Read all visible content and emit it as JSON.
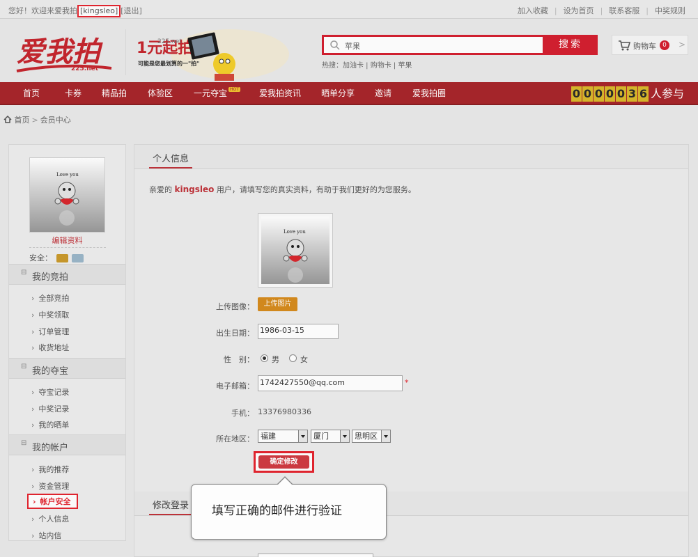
{
  "topbar": {
    "welcome_prefix": "您好！欢迎来爱我拍",
    "username": "[kingsleo]",
    "logout": "[退出]",
    "links": [
      "加入收藏",
      "设为首页",
      "联系客服",
      "中奖规则"
    ]
  },
  "header": {
    "logo_text": "爱我拍",
    "logo_domain": "225.net",
    "promo_domain": "225.net",
    "promo_title": "1元起拍",
    "promo_sub": "可能是您最划算的一\"拍\""
  },
  "search": {
    "value": "苹果",
    "button": "搜索",
    "hot_label": "热搜：",
    "hot_items": [
      "加油卡",
      "购物卡",
      "苹果"
    ]
  },
  "cart": {
    "label": "购物车",
    "count": "0"
  },
  "nav": {
    "items": [
      "首页",
      "卡券",
      "精品拍",
      "体验区",
      "一元夺宝",
      "爱我拍资讯",
      "晒单分享",
      "邀请",
      "爱我拍圈"
    ],
    "hot_badge": "HOT"
  },
  "counter": {
    "digits": [
      "0",
      "0",
      "0",
      "0",
      "0",
      "3",
      "6"
    ],
    "suffix": "人参与"
  },
  "breadcrumb": {
    "home": "首页",
    "current": "会员中心"
  },
  "sidebar": {
    "edit_profile": "编辑资料",
    "security_label": "安全：",
    "groups": [
      {
        "title": "我的竞拍",
        "items": [
          "全部竞拍",
          "中奖领取",
          "订单管理",
          "收货地址"
        ]
      },
      {
        "title": "我的夺宝",
        "items": [
          "夺宝记录",
          "中奖记录",
          "我的晒单"
        ]
      },
      {
        "title": "我的帐户",
        "items": [
          "我的推荐",
          "资金管理",
          "帐户安全",
          "个人信息",
          "站内信"
        ]
      }
    ]
  },
  "avatar": {
    "caption": "Love you"
  },
  "content": {
    "tab_title": "个人信息",
    "intro_prefix": "亲爱的",
    "intro_name": "kingsleo",
    "intro_suffix": "用户，请填写您的真实资料，有助于我们更好的为您服务。",
    "form": {
      "upload_label": "上传图像：",
      "upload_button": "上传图片",
      "birth_label": "出生日期：",
      "birth_value": "1986-03-15",
      "gender_label": "性　别：",
      "gender_options": [
        "男",
        "女"
      ],
      "gender_selected": "男",
      "email_label": "电子邮箱：",
      "email_value": "1742427550@qq.com",
      "email_required_mark": "*",
      "phone_label": "手机：",
      "phone_value": "13376980336",
      "region_label": "所在地区：",
      "province": "福建",
      "city": "厦门",
      "district": "思明区",
      "submit": "确定修改"
    },
    "second_tab_title": "修改登录"
  },
  "callout": {
    "text": "填写正确的邮件进行验证"
  },
  "colors": {
    "brand_red": "#a8262b",
    "highlight_red": "#e4252f",
    "counter_gold": "#d9b82b"
  }
}
